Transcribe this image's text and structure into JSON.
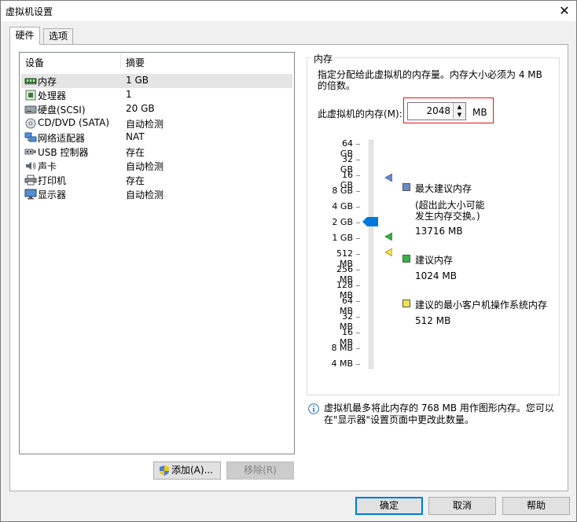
{
  "window": {
    "title": "虚拟机设置",
    "close": "✕"
  },
  "tabs": [
    {
      "label": "硬件"
    },
    {
      "label": "选项"
    }
  ],
  "devices": {
    "header": {
      "device": "设备",
      "summary": "摘要"
    },
    "items": [
      {
        "name": "内存",
        "summary": "1 GB",
        "icon": "memory-icon"
      },
      {
        "name": "处理器",
        "summary": "1",
        "icon": "processor-icon"
      },
      {
        "name": "硬盘(SCSI)",
        "summary": "20 GB",
        "icon": "hard-disk-icon"
      },
      {
        "name": "CD/DVD (SATA)",
        "summary": "自动检测",
        "icon": "cd-dvd-icon"
      },
      {
        "name": "网络适配器",
        "summary": "NAT",
        "icon": "network-adapter-icon"
      },
      {
        "name": "USB 控制器",
        "summary": "存在",
        "icon": "usb-icon"
      },
      {
        "name": "声卡",
        "summary": "自动检测",
        "icon": "sound-card-icon"
      },
      {
        "name": "打印机",
        "summary": "存在",
        "icon": "printer-icon"
      },
      {
        "name": "显示器",
        "summary": "自动检测",
        "icon": "display-icon"
      }
    ],
    "add_button": "添加(A)...",
    "remove_button": "移除(R)"
  },
  "memory": {
    "group_title": "内存",
    "description": "指定分配给此虚拟机的内存量。内存大小必须为 4 MB 的倍数。",
    "field_label": "此虚拟机的内存(M):",
    "value": "2048",
    "unit": "MB",
    "scale": [
      "64 GB",
      "32 GB",
      "16 GB",
      "8 GB",
      "4 GB",
      "2 GB",
      "1 GB",
      "512 MB",
      "256 MB",
      "128 MB",
      "64 MB",
      "32 MB",
      "16 MB",
      "8 MB",
      "4 MB"
    ],
    "legend": {
      "max": {
        "title": "最大建议内存",
        "note1": "(超出此大小可能",
        "note2": "发生内存交换。)",
        "value": "13716 MB",
        "color": "#6b8cc7"
      },
      "recommended": {
        "title": "建议内存",
        "value": "1024 MB",
        "color": "#3cb043"
      },
      "min_guest": {
        "title": "建议的最小客户机操作系统内存",
        "value": "512 MB",
        "color": "#f2e24a"
      }
    },
    "info_text": "虚拟机最多将此内存的 768 MB 用作图形内存。您可以在\"显示器\"设置页面中更改此数量。"
  },
  "footer": {
    "ok": "确定",
    "cancel": "取消",
    "help": "帮助"
  }
}
